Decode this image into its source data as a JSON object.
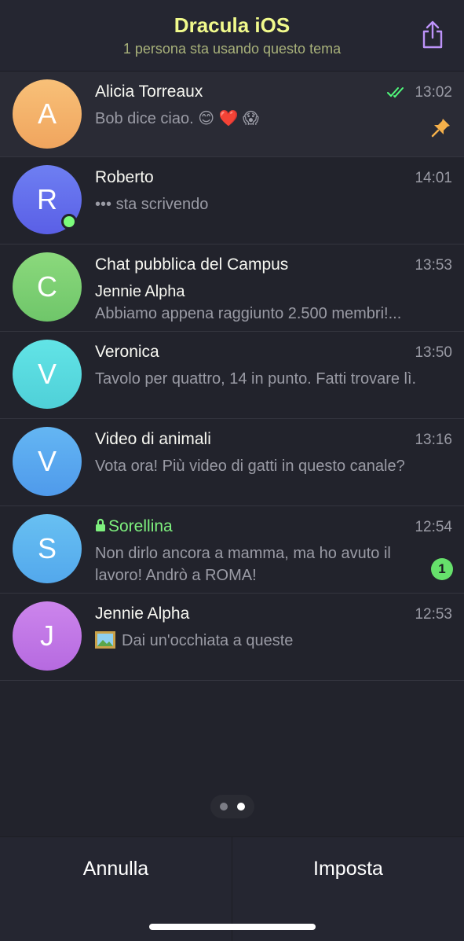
{
  "header": {
    "title": "Dracula iOS",
    "subtitle": "1 persona sta usando questo tema"
  },
  "chats": [
    {
      "initial": "A",
      "name": "Alicia Torreaux",
      "time": "13:02",
      "preview": "Bob dice ciao. 😊 ❤️ 😱",
      "pinned": true,
      "read": true,
      "avatar_color": "#f5b26b"
    },
    {
      "initial": "R",
      "name": "Roberto",
      "time": "14:01",
      "preview": "••• sta scrivendo",
      "online": true,
      "avatar_color": "#6571f0"
    },
    {
      "initial": "C",
      "name": "Chat pubblica del Campus",
      "time": "13:53",
      "sender": "Jennie Alpha",
      "preview": "Abbiamo appena raggiunto 2.500 membri!...",
      "avatar_color": "#7fd073"
    },
    {
      "initial": "V",
      "name": "Veronica",
      "time": "13:50",
      "preview": "Tavolo per quattro, 14 in punto. Fatti trovare lì.",
      "avatar_color": "#59dbe0"
    },
    {
      "initial": "V",
      "name": "Video di animali",
      "time": "13:16",
      "preview": "Vota ora! Più video di gatti in questo canale?",
      "avatar_color": "#58a9f0"
    },
    {
      "initial": "S",
      "name": "Sorellina",
      "time": "12:54",
      "preview": "Non dirlo ancora a mamma, ma ho avuto il lavoro! Andrò a ROMA!",
      "secret": true,
      "unread": "1",
      "avatar_color": "#5cb5ef"
    },
    {
      "initial": "J",
      "name": "Jennie Alpha",
      "time": "12:53",
      "preview": "Dai un'occhiata a queste",
      "photo": true,
      "avatar_color": "#c278e6"
    }
  ],
  "pager": {
    "pages": 2,
    "active": 2
  },
  "buttons": {
    "cancel": "Annulla",
    "set": "Imposta"
  },
  "colors": {
    "accent_yellow": "#f1fa8c",
    "online_green": "#7cfc7c",
    "secret_green": "#7ef07e",
    "read_ticks": "#50fa7b",
    "share_icon": "#bd93f9"
  },
  "icons": {
    "share": "share-icon",
    "pin": "pin-icon",
    "lock": "lock-icon",
    "read": "double-check-icon",
    "photo": "photo-icon"
  }
}
